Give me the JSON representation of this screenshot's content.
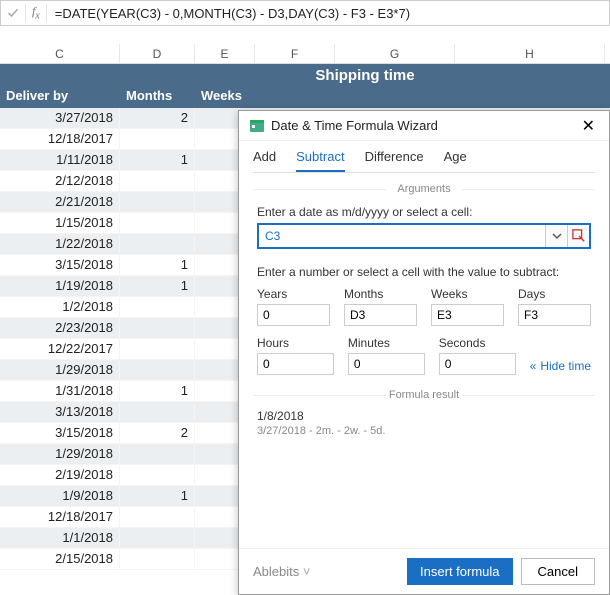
{
  "formulaBar": {
    "formula": "=DATE(YEAR(C3) - 0,MONTH(C3) - D3,DAY(C3) - F3 - E3*7)"
  },
  "columns": {
    "c": "C",
    "d": "D",
    "e": "E",
    "f": "F",
    "g": "G",
    "h": "H"
  },
  "bandTitle": "Shipping time",
  "headers": {
    "deliverBy": "Deliver by",
    "months": "Months",
    "weeks": "Weeks"
  },
  "rows": [
    {
      "date": "3/27/2018",
      "months": "2"
    },
    {
      "date": "12/18/2017",
      "months": ""
    },
    {
      "date": "1/11/2018",
      "months": "1"
    },
    {
      "date": "2/12/2018",
      "months": ""
    },
    {
      "date": "2/21/2018",
      "months": ""
    },
    {
      "date": "1/15/2018",
      "months": ""
    },
    {
      "date": "1/22/2018",
      "months": ""
    },
    {
      "date": "3/15/2018",
      "months": "1"
    },
    {
      "date": "1/19/2018",
      "months": "1"
    },
    {
      "date": "1/2/2018",
      "months": ""
    },
    {
      "date": "2/23/2018",
      "months": ""
    },
    {
      "date": "12/22/2017",
      "months": ""
    },
    {
      "date": "1/29/2018",
      "months": ""
    },
    {
      "date": "1/31/2018",
      "months": "1"
    },
    {
      "date": "3/13/2018",
      "months": ""
    },
    {
      "date": "3/15/2018",
      "months": "2"
    },
    {
      "date": "1/29/2018",
      "months": ""
    },
    {
      "date": "2/19/2018",
      "months": ""
    },
    {
      "date": "1/9/2018",
      "months": "1"
    },
    {
      "date": "12/18/2017",
      "months": ""
    },
    {
      "date": "1/1/2018",
      "months": ""
    },
    {
      "date": "2/15/2018",
      "months": ""
    }
  ],
  "wizard": {
    "title": "Date & Time Formula Wizard",
    "tabs": {
      "add": "Add",
      "subtract": "Subtract",
      "difference": "Difference",
      "age": "Age"
    },
    "argumentsLabel": "Arguments",
    "dateLabel": "Enter a date as m/d/yyyy or select a cell:",
    "dateValue": "C3",
    "numberLabel": "Enter a number or select a cell with the value to subtract:",
    "fields": {
      "years": {
        "label": "Years",
        "value": "0"
      },
      "months": {
        "label": "Months",
        "value": "D3"
      },
      "weeks": {
        "label": "Weeks",
        "value": "E3"
      },
      "days": {
        "label": "Days",
        "value": "F3"
      },
      "hours": {
        "label": "Hours",
        "value": "0"
      },
      "minutes": {
        "label": "Minutes",
        "value": "0"
      },
      "seconds": {
        "label": "Seconds",
        "value": "0"
      }
    },
    "hideTime": "Hide time",
    "resultLabel": "Formula result",
    "result1": "1/8/2018",
    "result2": "3/27/2018 - 2m. - 2w. - 5d.",
    "brand": "Ablebits",
    "insert": "Insert formula",
    "cancel": "Cancel"
  }
}
